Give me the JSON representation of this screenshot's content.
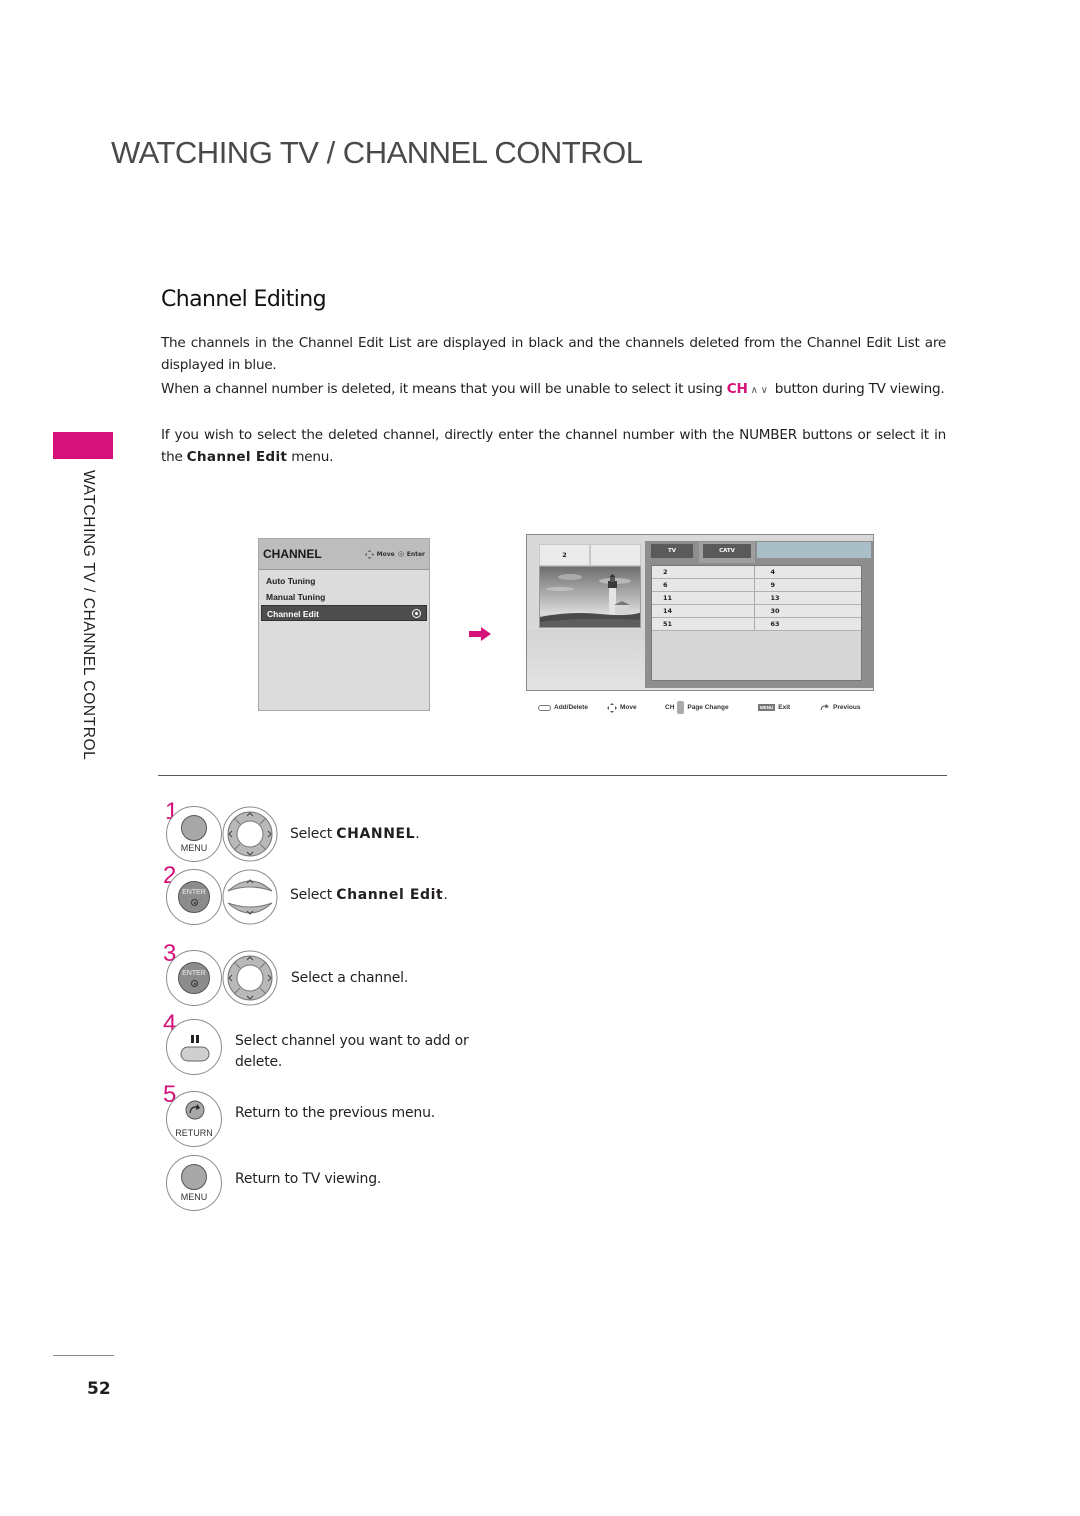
{
  "header": {
    "title": "WATCHING TV / CHANNEL CONTROL"
  },
  "side_tab": {
    "label": "WATCHING TV / CHANNEL CONTROL",
    "accent_color": "#d4127a"
  },
  "section": {
    "title": "Channel Editing",
    "paragraphs": {
      "p1": "The channels in the Channel Edit List are displayed in black and the channels deleted from the Channel Edit List are displayed in blue.",
      "p2_before": "When a channel number is deleted, it means that you will be unable to select it using ",
      "p2_ch": "CH",
      "p2_arrows": "∧ ∨",
      "p2_after": " button during TV viewing.",
      "p3_before": "If you wish to select the deleted channel, directly enter the channel number with the NUMBER buttons or select it in the ",
      "p3_term": "Channel Edit",
      "p3_after": " menu."
    }
  },
  "osd_menu": {
    "title": "CHANNEL",
    "hint_move": "Move",
    "hint_enter": "Enter",
    "items": [
      {
        "label": "Auto Tuning",
        "selected": false
      },
      {
        "label": "Manual Tuning",
        "selected": false
      },
      {
        "label": "Channel Edit",
        "selected": true
      }
    ]
  },
  "edit_screen": {
    "preview_channel": "2",
    "tabs": [
      "TV",
      "CATV"
    ],
    "rows": [
      [
        "2",
        "4"
      ],
      [
        "6",
        "9"
      ],
      [
        "11",
        "13"
      ],
      [
        "14",
        "30"
      ],
      [
        "51",
        "63"
      ]
    ],
    "legend": {
      "add_delete": "Add/Delete",
      "move": "Move",
      "ch": "CH",
      "page_change": "Page Change",
      "menu_key": "MENU",
      "exit": "Exit",
      "previous": "Previous"
    }
  },
  "steps": [
    {
      "number": "1",
      "button": "MENU",
      "text_before": "Select ",
      "text_bold": "CHANNEL",
      "text_after": "."
    },
    {
      "number": "2",
      "button": "ENTER",
      "text_before": "Select ",
      "text_bold": "Channel Edit",
      "text_after": "."
    },
    {
      "number": "3",
      "button": "ENTER",
      "text": "Select a channel."
    },
    {
      "number": "4",
      "button": "PAUSE",
      "text": "Select channel you want to add or delete."
    },
    {
      "number": "5",
      "button": "RETURN",
      "text": "Return to the previous menu."
    },
    {
      "number": "",
      "button": "MENU",
      "text": "Return to TV viewing."
    }
  ],
  "footer": {
    "page_number": "52"
  }
}
